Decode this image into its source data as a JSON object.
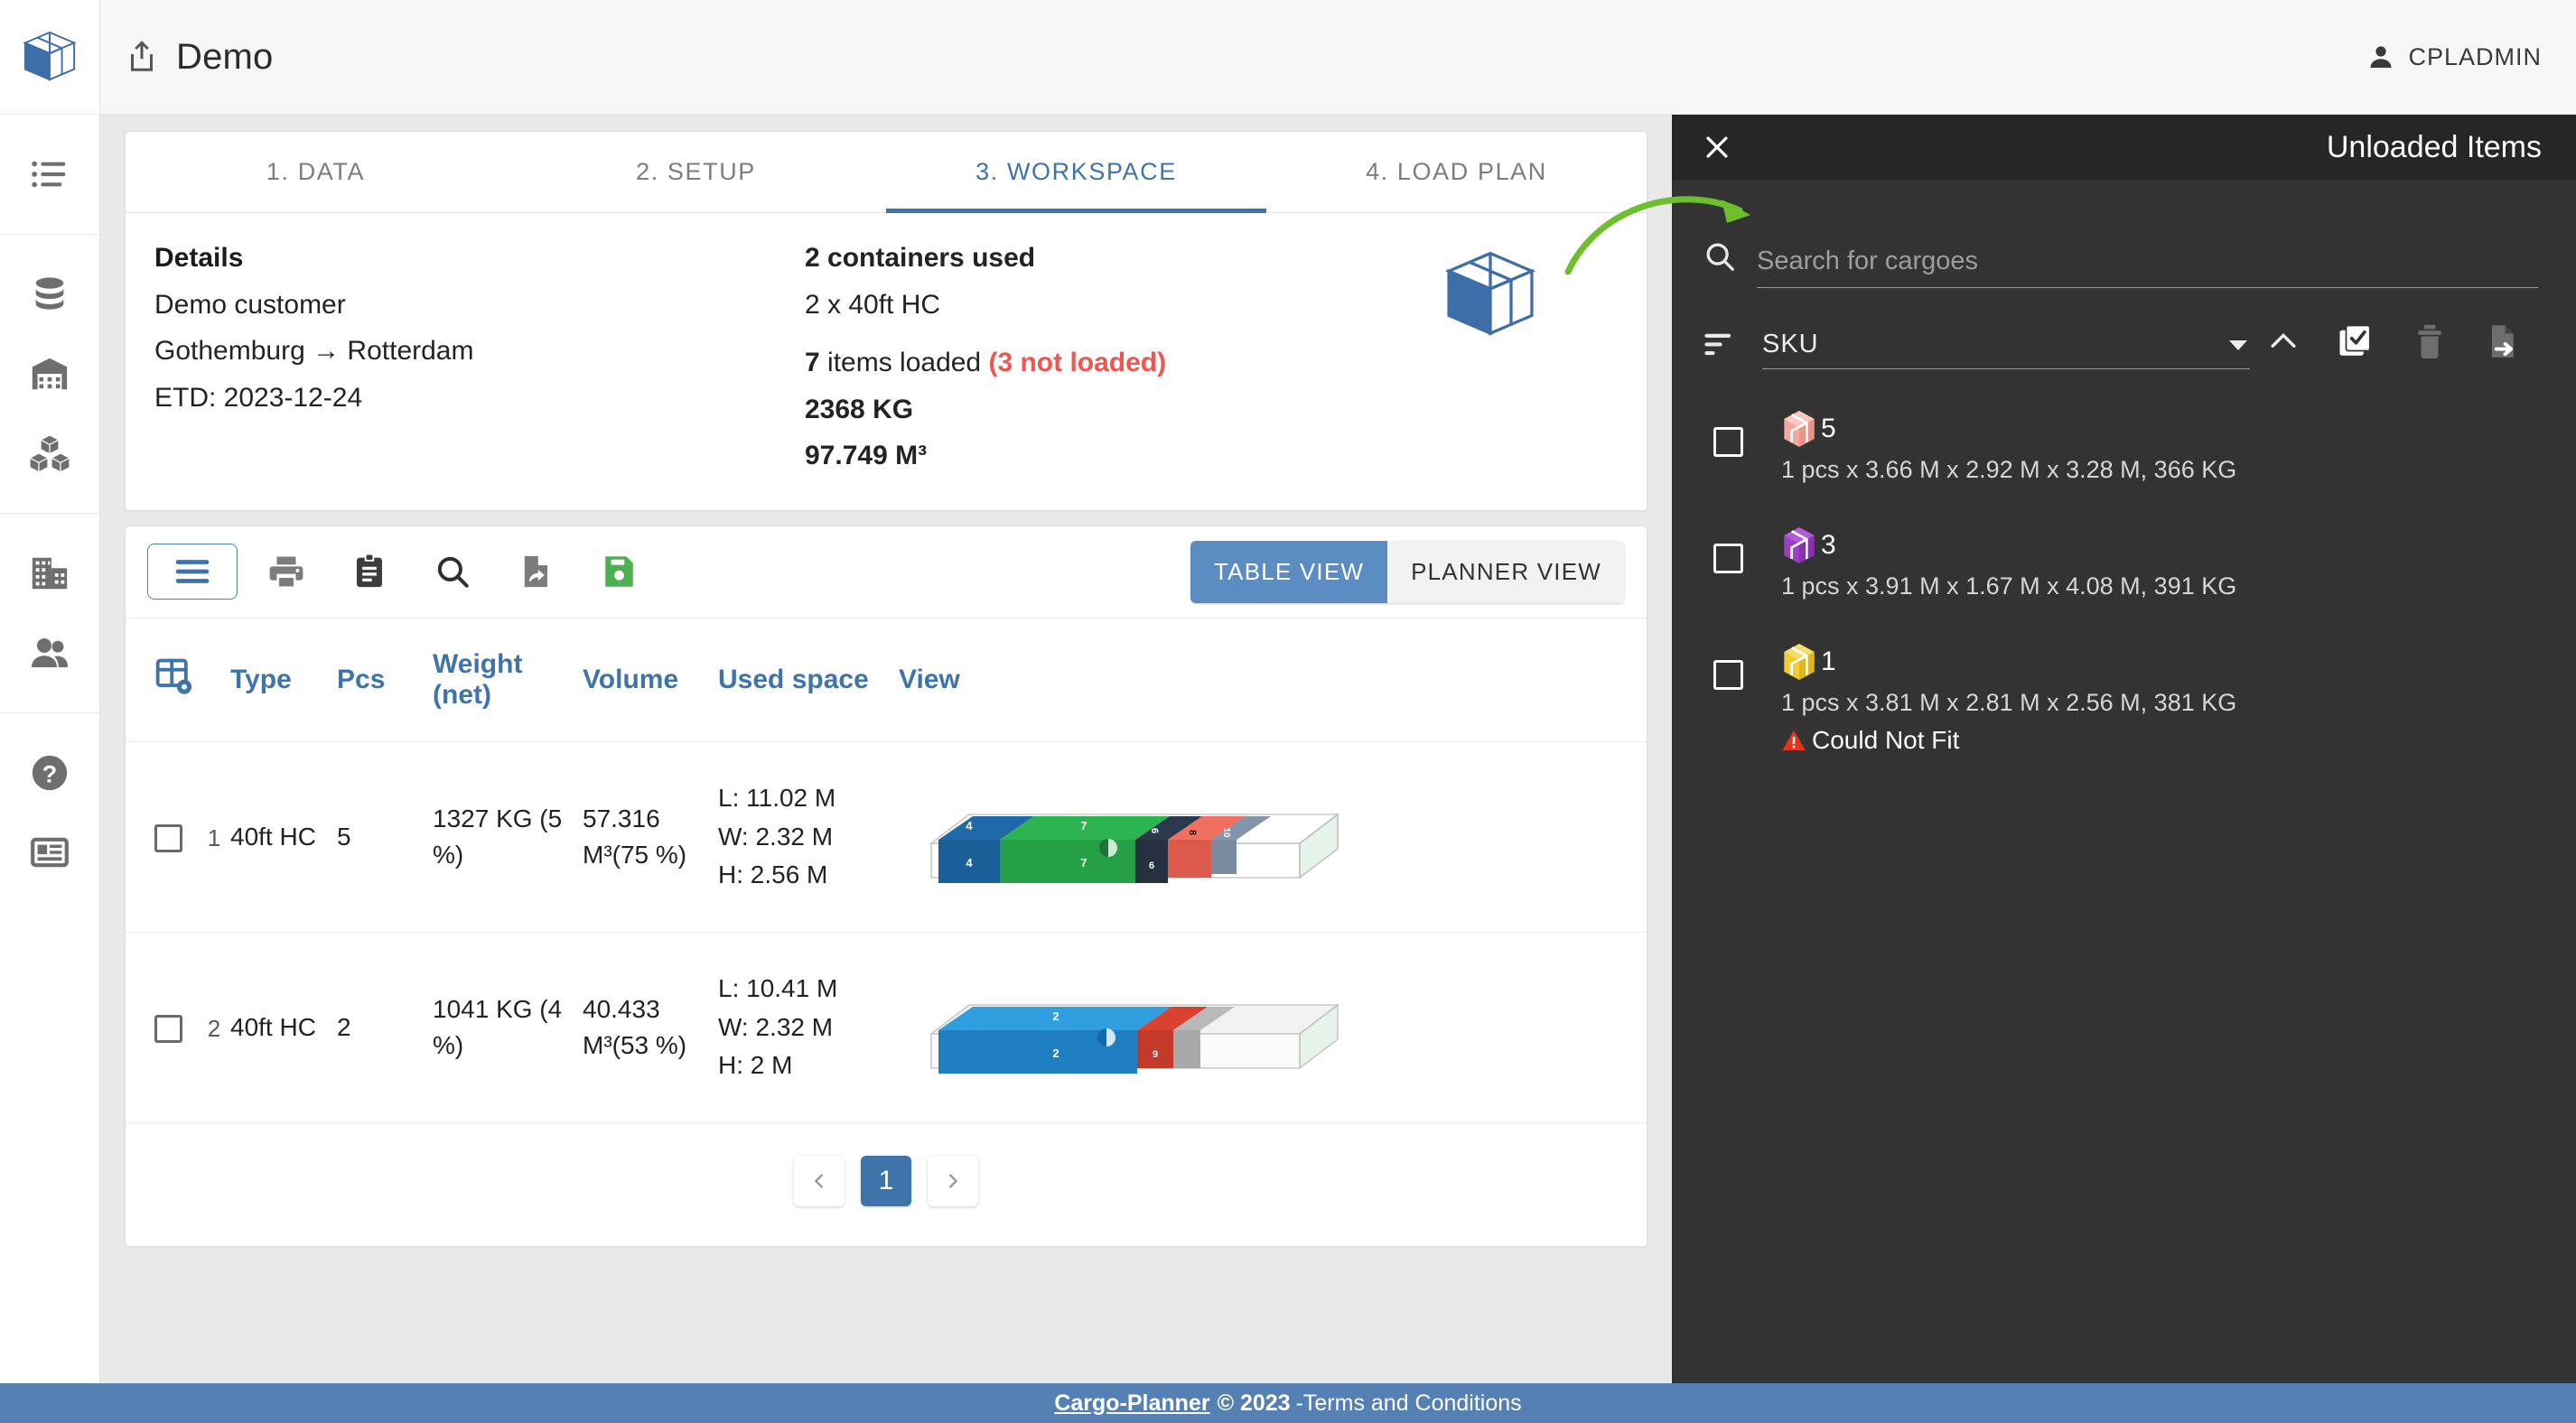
{
  "app": {
    "logo_icon": "cargo-box-logo",
    "share_icon": "share-icon",
    "title": "Demo",
    "user": "CPLADMIN",
    "user_icon": "person-icon"
  },
  "sidebar": {
    "items": [
      {
        "icon": "list-icon",
        "name": "sidebar-item-list"
      },
      {
        "icon": "database-icon",
        "name": "sidebar-item-database"
      },
      {
        "icon": "warehouse-icon",
        "name": "sidebar-item-warehouse"
      },
      {
        "icon": "boxes-icon",
        "name": "sidebar-item-boxes"
      },
      {
        "icon": "building-icon",
        "name": "sidebar-item-building"
      },
      {
        "icon": "users-icon",
        "name": "sidebar-item-users"
      },
      {
        "icon": "help-icon",
        "name": "sidebar-item-help"
      },
      {
        "icon": "news-icon",
        "name": "sidebar-item-news"
      }
    ]
  },
  "tabs": [
    {
      "label": "1. DATA",
      "active": false
    },
    {
      "label": "2. SETUP",
      "active": false
    },
    {
      "label": "3. WORKSPACE",
      "active": true
    },
    {
      "label": "4. LOAD PLAN",
      "active": false
    }
  ],
  "details": {
    "heading": "Details",
    "customer": "Demo customer",
    "route": "Gothemburg → Rotterdam",
    "etd": "ETD: 2023-12-24"
  },
  "summary": {
    "containers_used": "2 containers used",
    "container_breakdown": "2 x 40ft HC",
    "items_loaded_count": "7",
    "items_loaded_text": " items loaded ",
    "not_loaded": "(3 not loaded)",
    "total_weight": "2368 KG",
    "total_volume": "97.749 M³"
  },
  "toolbar": {
    "buttons": [
      {
        "name": "list-view-button",
        "icon": "hamburger-icon",
        "active": true
      },
      {
        "name": "print-button",
        "icon": "printer-icon",
        "active": false
      },
      {
        "name": "report-button",
        "icon": "clipboard-icon",
        "active": false
      },
      {
        "name": "inspect-button",
        "icon": "search-icon",
        "active": false
      },
      {
        "name": "revert-button",
        "icon": "file-undo-icon",
        "active": false
      },
      {
        "name": "save-button",
        "icon": "floppy-save-icon",
        "active": false
      }
    ],
    "view_toggle": [
      {
        "label": "TABLE VIEW",
        "active": true
      },
      {
        "label": "PLANNER VIEW",
        "active": false
      }
    ]
  },
  "table": {
    "settings_icon": "table-settings-icon",
    "columns": [
      "Type",
      "Pcs",
      "Weight (net)",
      "Volume",
      "Used space",
      "View"
    ],
    "rows": [
      {
        "index": "1",
        "type": "40ft HC",
        "pcs": "5",
        "weight": "1327 KG (5 %)",
        "volume": "57.316 M³(75 %)",
        "used_space": {
          "l": "L: 11.02 M",
          "w": "W: 2.32 M",
          "h": "H: 2.56 M"
        },
        "view_icon": "container-3d-preview-1"
      },
      {
        "index": "2",
        "type": "40ft HC",
        "pcs": "2",
        "weight": "1041 KG (4 %)",
        "volume": "40.433 M³(53 %)",
        "used_space": {
          "l": "L: 10.41 M",
          "w": "W: 2.32 M",
          "h": "H: 2 M"
        },
        "view_icon": "container-3d-preview-2"
      }
    ]
  },
  "pagination": {
    "prev_icon": "chevron-left-icon",
    "next_icon": "chevron-right-icon",
    "pages": [
      "1"
    ],
    "current": "1"
  },
  "panel": {
    "close_icon": "close-icon",
    "title": "Unloaded Items",
    "search": {
      "icon": "search-icon",
      "value": "",
      "placeholder": "Search for cargoes"
    },
    "sort": {
      "icon": "sort-icon",
      "value": "SKU",
      "caret_icon": "chevron-down-icon",
      "direction_icon": "chevron-up-icon"
    },
    "actions": [
      {
        "name": "select-all-button",
        "icon": "check-square-icon"
      },
      {
        "name": "delete-button",
        "icon": "trash-icon"
      },
      {
        "name": "export-button",
        "icon": "file-export-icon"
      }
    ],
    "items": [
      {
        "qty": "5",
        "color": "#f4a79c",
        "dims": "1 pcs x 3.66 M x 2.92 M x 3.28 M, 366 KG",
        "warning": null
      },
      {
        "qty": "3",
        "color": "#9b3fc4",
        "dims": "1 pcs x 3.91 M x 1.67 M x 4.08 M, 391 KG",
        "warning": null
      },
      {
        "qty": "1",
        "color": "#f2cc33",
        "dims": "1 pcs x 3.81 M x 2.81 M x 2.56 M, 381 KG",
        "warning": "Could Not Fit"
      }
    ]
  },
  "footer": {
    "brand": "Cargo-Planner",
    "copyright": "© 2023",
    "terms": "-Terms and Conditions"
  },
  "colors": {
    "accent_blue": "#3f74ab",
    "footer_blue": "#5580b4",
    "panel_dark": "#333333",
    "panel_head_dark": "#262626",
    "danger_red": "#f2554d",
    "save_green": "#4caf50",
    "annotation_green": "#6dbf2e"
  }
}
